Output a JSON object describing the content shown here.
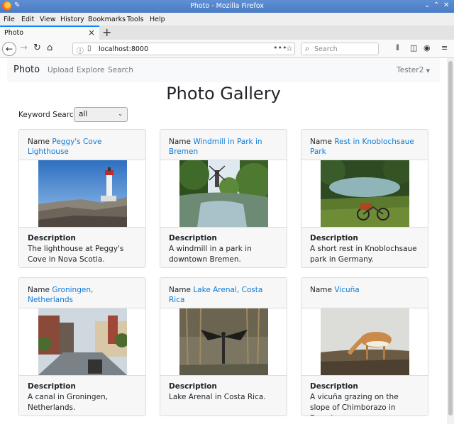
{
  "browser": {
    "window_title": "Photo - Mozilla Firefox",
    "menu": [
      "File",
      "Edit",
      "View",
      "History",
      "Bookmarks",
      "Tools",
      "Help"
    ],
    "tab_title": "Photo",
    "url": "localhost:8000",
    "search_placeholder": "Search"
  },
  "app": {
    "brand": "Photo",
    "nav_links": [
      "Upload",
      "Explore",
      "Search"
    ],
    "user": "Tester2"
  },
  "page": {
    "title": "Photo Gallery",
    "keyword_label": "Keyword Search:",
    "keyword_value": "all",
    "name_label": "Name",
    "description_label": "Description"
  },
  "photos": [
    {
      "name": "Peggy's Cove Lighthouse",
      "description": "The lighthouse at Peggy's Cove in Nova Scotia."
    },
    {
      "name": "Windmill in Park in Bremen",
      "description": "A windmill in a park in downtown Bremen."
    },
    {
      "name": "Rest in Knoblochsaue Park",
      "description": "A short rest in Knoblochsaue park in Germany."
    },
    {
      "name": "Groningen, Netherlands",
      "description": "A canal in Groningen, Netherlands."
    },
    {
      "name": "Lake Arenal, Costa Rica",
      "description": "Lake Arenal in Costa Rica."
    },
    {
      "name": "Vicuña",
      "description": "A vicuña grazing on the slope of Chimborazo in Ecuador"
    }
  ]
}
